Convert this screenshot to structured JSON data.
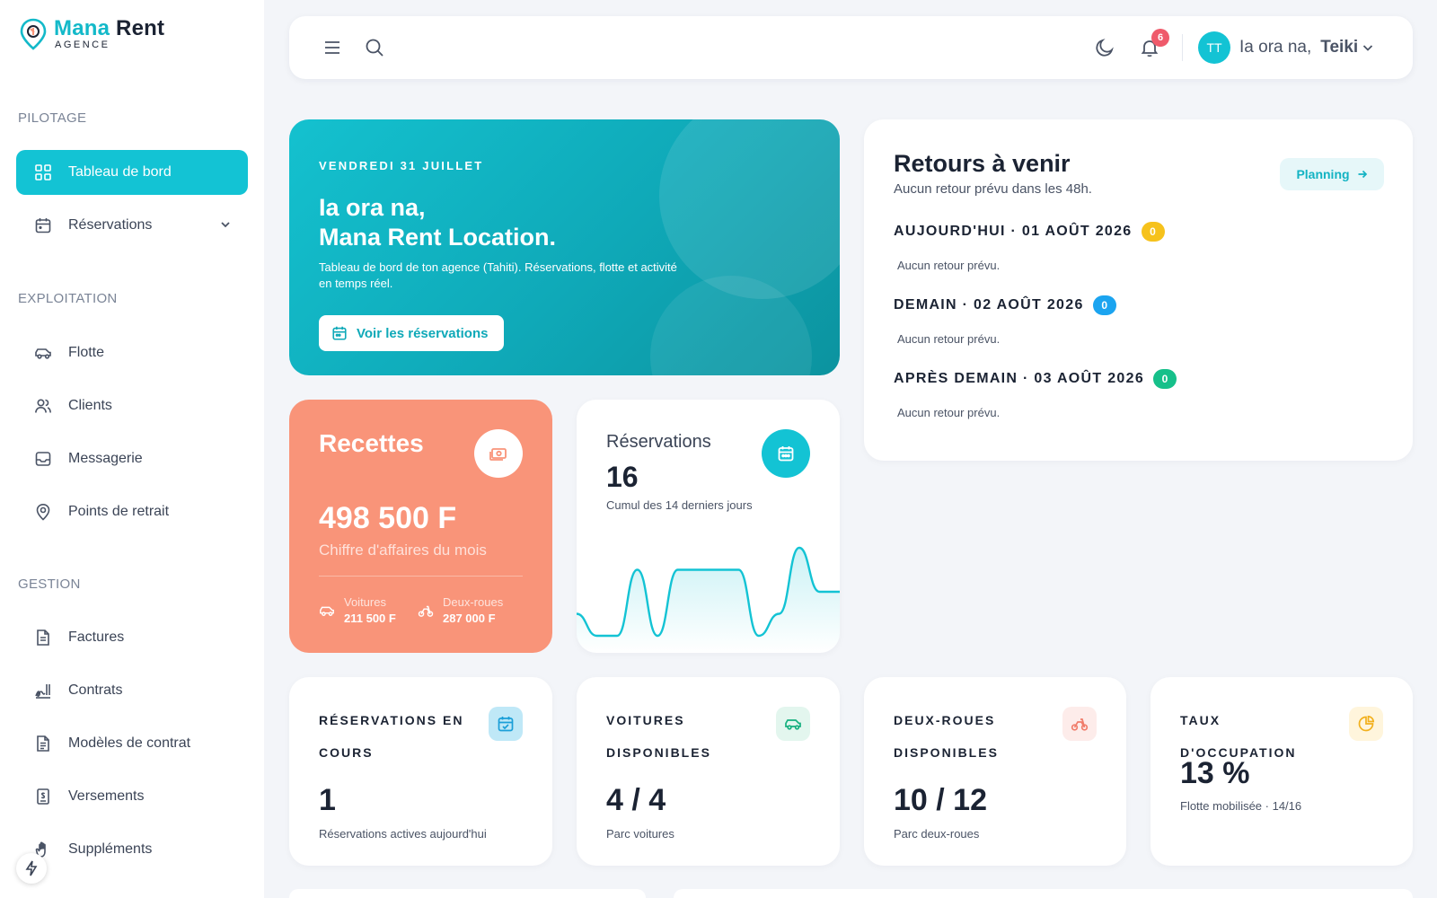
{
  "brand": {
    "name_part1": "Mana",
    "name_part2": "Rent",
    "subtitle": "AGENCE"
  },
  "sidebar": {
    "sections": [
      {
        "title": "PILOTAGE"
      },
      {
        "title": "EXPLOITATION"
      },
      {
        "title": "GESTION"
      }
    ],
    "items": [
      {
        "label": "Tableau de bord",
        "icon": "dashboard-icon",
        "active": true
      },
      {
        "label": "Réservations",
        "icon": "calendar-icon",
        "expandable": true
      },
      {
        "label": "Flotte",
        "icon": "car-icon"
      },
      {
        "label": "Clients",
        "icon": "users-icon"
      },
      {
        "label": "Messagerie",
        "icon": "inbox-icon"
      },
      {
        "label": "Points de retrait",
        "icon": "map-pin-icon"
      },
      {
        "label": "Factures",
        "icon": "invoice-icon"
      },
      {
        "label": "Contrats",
        "icon": "signature-icon"
      },
      {
        "label": "Modèles de contrat",
        "icon": "document-icon"
      },
      {
        "label": "Versements",
        "icon": "receipt-icon"
      },
      {
        "label": "Suppléments",
        "icon": "hand-icon"
      }
    ]
  },
  "topbar": {
    "notifications_count": "6",
    "avatar_initials": "TT",
    "greeting": "Ia ora na,",
    "user_name": "Teiki"
  },
  "hero": {
    "date": "VENDREDI 31 JUILLET",
    "line1": "Ia ora na,",
    "line2": "Mana Rent Location.",
    "description": "Tableau de bord de ton agence (Tahiti). Réservations, flotte et activité en temps réel.",
    "button_label": "Voir les réservations"
  },
  "recettes": {
    "title": "Recettes",
    "amount": "498 500 F",
    "subtitle": "Chiffre d'affaires du mois",
    "voitures_label": "Voitures",
    "voitures_value": "211 500 F",
    "deux_roues_label": "Deux-roues",
    "deux_roues_value": "287 000 F"
  },
  "reservations_card": {
    "title": "Réservations",
    "value": "16",
    "subtitle": "Cumul des 14 derniers jours"
  },
  "chart_data": {
    "type": "area",
    "series": [
      {
        "values": [
          1,
          0,
          0,
          3,
          0,
          3,
          3,
          3,
          3,
          0,
          1,
          4,
          2,
          2
        ]
      }
    ]
  },
  "retours": {
    "title": "Retours à venir",
    "subtitle": "Aucun retour prévu dans les 48h.",
    "planning_label": "Planning",
    "days": [
      {
        "label": "AUJOURD'HUI · 01 AOÛT 2026",
        "count": "0",
        "color": "#f6c21c",
        "empty_text": "Aucun retour prévu."
      },
      {
        "label": "DEMAIN · 02 AOÛT 2026",
        "count": "0",
        "color": "#1ba4f0",
        "empty_text": "Aucun retour prévu."
      },
      {
        "label": "APRÈS DEMAIN · 03 AOÛT 2026",
        "count": "0",
        "color": "#16c08a",
        "empty_text": "Aucun retour prévu."
      }
    ]
  },
  "stats": [
    {
      "label": "RÉSERVATIONS EN COURS",
      "value": "1",
      "subtitle": "Réservations actives aujourd'hui",
      "icon": "calendar-check-icon"
    },
    {
      "label": "VOITURES DISPONIBLES",
      "value": "4 / 4",
      "subtitle": "Parc voitures",
      "icon": "car-icon"
    },
    {
      "label": "DEUX-ROUES DISPONIBLES",
      "value": "10 / 12",
      "subtitle": "Parc deux-roues",
      "icon": "scooter-icon"
    },
    {
      "label": "TAUX D'OCCUPATION",
      "value": "13 %",
      "subtitle": "Flotte mobilisée · 14/16",
      "icon": "pie-chart-icon"
    }
  ],
  "colors": {
    "accent": "#13c3d4",
    "recettes": "#f99479",
    "badge": "#ef5a6b"
  }
}
